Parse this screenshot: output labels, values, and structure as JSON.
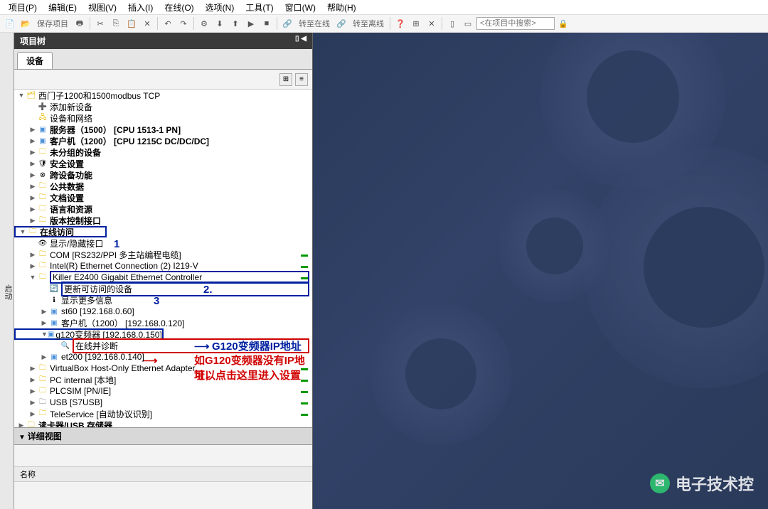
{
  "menu": {
    "project": "项目(P)",
    "edit": "编辑(E)",
    "view": "视图(V)",
    "insert": "插入(I)",
    "online": "在线(O)",
    "options": "选项(N)",
    "tools": "工具(T)",
    "window": "窗口(W)",
    "help": "帮助(H)"
  },
  "toolbar": {
    "save": "保存项目",
    "goOnline": "转至在线",
    "goOffline": "转至离线",
    "searchPlaceholder": "<在项目中搜索>"
  },
  "sidebar": {
    "start": "启动"
  },
  "panel": {
    "title": "项目树",
    "tab": "设备"
  },
  "tree": {
    "root": "西门子1200和1500modbus TCP",
    "addDevice": "添加新设备",
    "devicesNetworks": "设备和网络",
    "server": "服务器（1500） [CPU 1513-1 PN]",
    "client": "客户机（1200） [CPU 1215C DC/DC/DC]",
    "ungrouped": "未分组的设备",
    "security": "安全设置",
    "crossDevice": "跨设备功能",
    "commonData": "公共数据",
    "docSettings": "文档设置",
    "langRes": "语言和资源",
    "versionCtrl": "版本控制接口",
    "onlineAccess": "在线访问",
    "showHide": "显示/隐藏接口",
    "com": "COM [RS232/PPI 多主站编程电缆]",
    "intel": "Intel(R) Ethernet Connection (2) I219-V",
    "killer": "Killer E2400 Gigabit Ethernet Controller",
    "updateDevices": "更新可访问的设备",
    "showMore": "显示更多信息",
    "st60": "st60 [192.168.0.60]",
    "clientIp": "客户机（1200） [192.168.0.120]",
    "g120": "g120变频器 [192.168.0.150]",
    "onlineDiag": "在线并诊断",
    "et200": "et200 [192.168.0.140]",
    "virtualbox": "VirtualBox Host-Only Ethernet Adapter",
    "pcInternal": "PC internal [本地]",
    "plcsim": "PLCSIM [PN/IE]",
    "usb": "USB [S7USB]",
    "teleservice": "TeleService [自动协议识别]",
    "cardReader": "读卡器/USB 存储器"
  },
  "annotations": {
    "n1": "1",
    "n2": "2.",
    "n3": "3",
    "ipLabel": "G120变频器IP地址",
    "noIp1": "如G120变频器没有IP地址，",
    "noIp2": "可以点击这里进入设置"
  },
  "detail": {
    "title": "详细视图",
    "colName": "名称"
  },
  "watermark": {
    "text": "电子技术控"
  }
}
